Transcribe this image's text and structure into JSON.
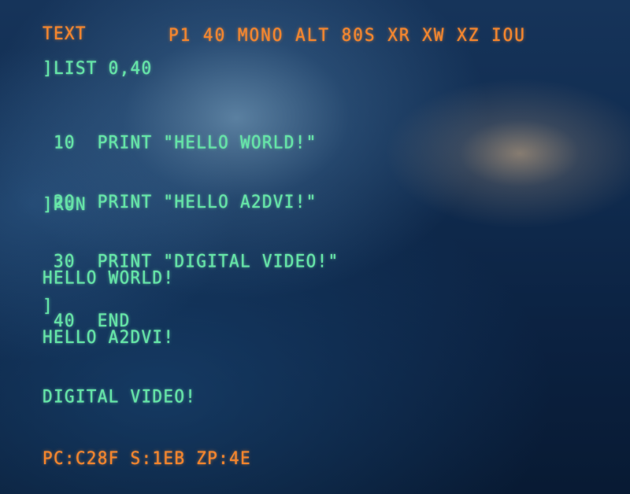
{
  "status_bar": {
    "mode": "TEXT",
    "flags": "P1 40 MONO ALT 80S XR XW XZ IOU"
  },
  "console": {
    "command_list": "]LIST 0,40",
    "program_lines": [
      " 10  PRINT \"HELLO WORLD!\"",
      " 20  PRINT \"HELLO A2DVI!\"",
      " 30  PRINT \"DIGITAL VIDEO!\"",
      " 40  END"
    ],
    "command_run": "]RUN",
    "output_lines": [
      "HELLO WORLD!",
      "HELLO A2DVI!",
      "DIGITAL VIDEO!"
    ],
    "cursor_prompt": "]"
  },
  "registers": "PC:C28F S:1EB ZP:4E",
  "colors": {
    "text_green": "#63e6a6",
    "status_orange": "#f7842a"
  }
}
